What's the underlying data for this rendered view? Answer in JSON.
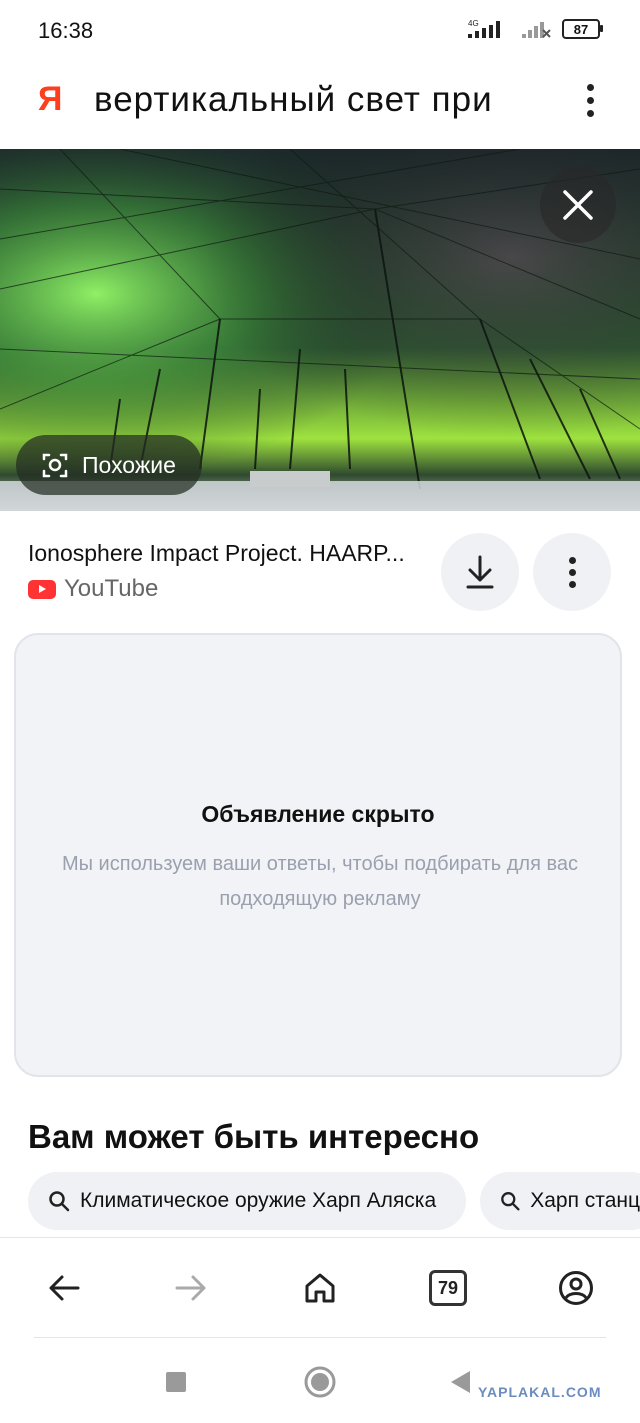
{
  "status_bar": {
    "time": "16:38",
    "network": "4G",
    "battery": "87"
  },
  "search": {
    "logo": "Я",
    "query": "вертикальный свет при"
  },
  "image_overlay": {
    "similar_label": "Похожие"
  },
  "result": {
    "title": "Ionosphere Impact Project. HAARP...",
    "source": "YouTube"
  },
  "ad": {
    "title": "Объявление скрыто",
    "text": "Мы используем ваши ответы, чтобы подбирать для вас подходящую рекламу"
  },
  "recommendations": {
    "heading": "Вам может быть интересно",
    "chips": [
      "Климатическое оружие Харп Аляска",
      "Харп станц"
    ]
  },
  "bottom_nav": {
    "tabs_count": "79"
  },
  "watermark": "YAPLAKAL.COM",
  "icons": [
    "back-arrow-icon",
    "forward-arrow-icon",
    "home-icon",
    "tabs-icon",
    "profile-icon",
    "close-icon",
    "camera-search-icon",
    "download-icon",
    "more-icon",
    "search-icon"
  ],
  "colors": {
    "yandex_red": "#fc3f1d",
    "youtube_red": "#ff3333",
    "ad_text": "#9aa0ad",
    "aurora_green": "#6fe04c"
  }
}
